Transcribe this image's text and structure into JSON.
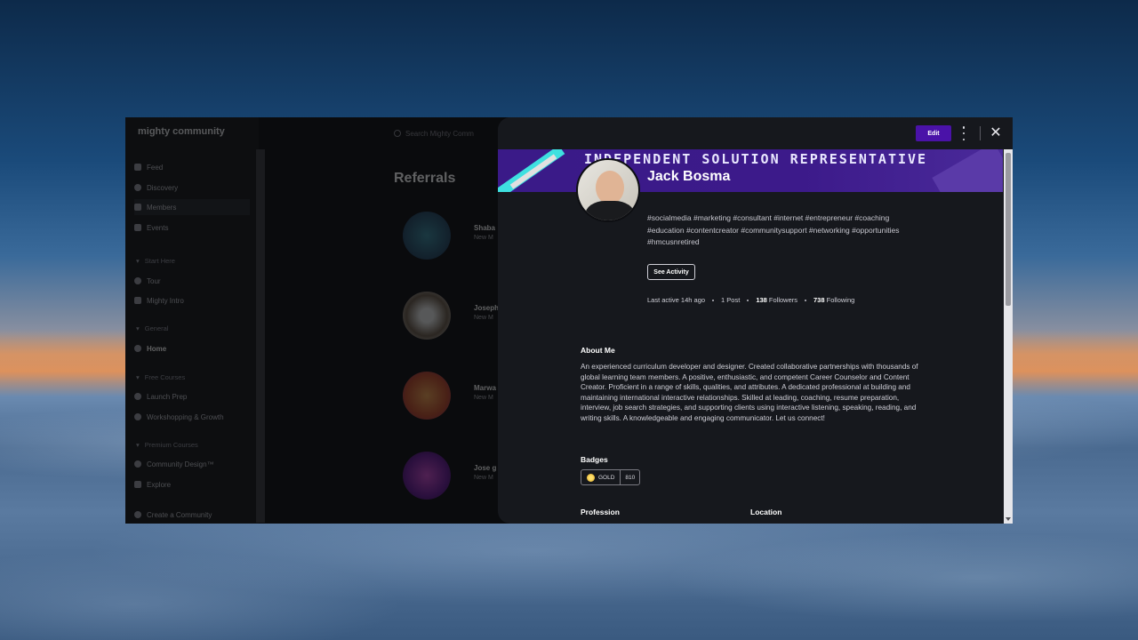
{
  "app": {
    "logo": "mighty community",
    "search_placeholder": "Search Mighty Comm",
    "page_title": "Referrals"
  },
  "sidebar": {
    "nav": [
      "Feed",
      "Discovery",
      "Members",
      "Events"
    ],
    "groups": [
      {
        "title": "Start Here",
        "items": [
          "Tour",
          "Mighty Intro"
        ]
      },
      {
        "title": "General",
        "items": [
          "Home"
        ]
      },
      {
        "title": "Free Courses",
        "items": [
          "Launch Prep",
          "Workshopping & Growth"
        ]
      },
      {
        "title": "Premium Courses",
        "items": [
          "Community Design™",
          "Explore"
        ]
      }
    ],
    "create": "Create a Community"
  },
  "members": [
    {
      "name": "Shaba",
      "sub": "New M"
    },
    {
      "name": "Joseph",
      "sub": "New M"
    },
    {
      "name": "Marwa",
      "sub": "New M"
    },
    {
      "name": "Jose g",
      "sub": "New M"
    }
  ],
  "profile": {
    "edit_label": "Edit",
    "banner_title": "INDEPENDENT SOLUTION REPRESENTATIVE",
    "name": "Jack Bosma",
    "tags": "#socialmedia #marketing #consultant #internet #entrepreneur #coaching #education #contentcreator #communitysupport #networking #opportunities #hmcusnretired",
    "see_activity": "See Activity",
    "last_active": "Last active 14h ago",
    "posts": "1 Post",
    "followers_count": "138",
    "followers_label": "Followers",
    "following_count": "738",
    "following_label": "Following",
    "about_title": "About Me",
    "about_text": "An experienced curriculum developer and designer. Created collaborative partnerships with thousands of global learning team members. A positive, enthusiastic, and competent Career Counselor and Content Creator. Proficient in a range of skills, qualities, and attributes. A dedicated professional at building and maintaining international interactive relationships. Skilled at leading, coaching, resume preparation, interview, job search strategies, and supporting clients using interactive listening, speaking, reading, and writing skills. A knowledgeable and engaging communicator. Let us connect!",
    "badges_title": "Badges",
    "badge_label": "GOLD",
    "badge_value": "810",
    "profession_title": "Profession",
    "location_title": "Location"
  },
  "colors": {
    "accent": "#4a12a8",
    "banner": "#3a1a88",
    "panel_bg": "#16181d"
  }
}
